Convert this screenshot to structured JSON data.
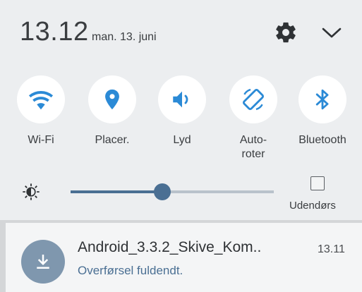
{
  "status": {
    "time": "13.12",
    "date": "man. 13. juni"
  },
  "header_icons": [
    "gear-icon",
    "chevron-down-icon"
  ],
  "toggles": [
    {
      "label": "Wi-Fi",
      "icon": "wifi-icon"
    },
    {
      "label": "Placer.",
      "icon": "location-icon"
    },
    {
      "label": "Lyd",
      "icon": "sound-icon"
    },
    {
      "label": "Auto-\nroter",
      "icon": "auto-rotate-icon"
    },
    {
      "label": "Bluetooth",
      "icon": "bluetooth-icon"
    }
  ],
  "brightness": {
    "level": 0.45,
    "outdoor_label": "Udendørs",
    "outdoor_checked": false
  },
  "notification": {
    "title": "Android_3.3.2_Skive_Kom..",
    "time": "13.11",
    "subtitle": "Overførsel fuldendt.",
    "icon": "download-icon"
  },
  "colors": {
    "accent": "#4a6f93",
    "panel_bg": "#eceef0",
    "toggle_icon": "#2b8ad6"
  }
}
